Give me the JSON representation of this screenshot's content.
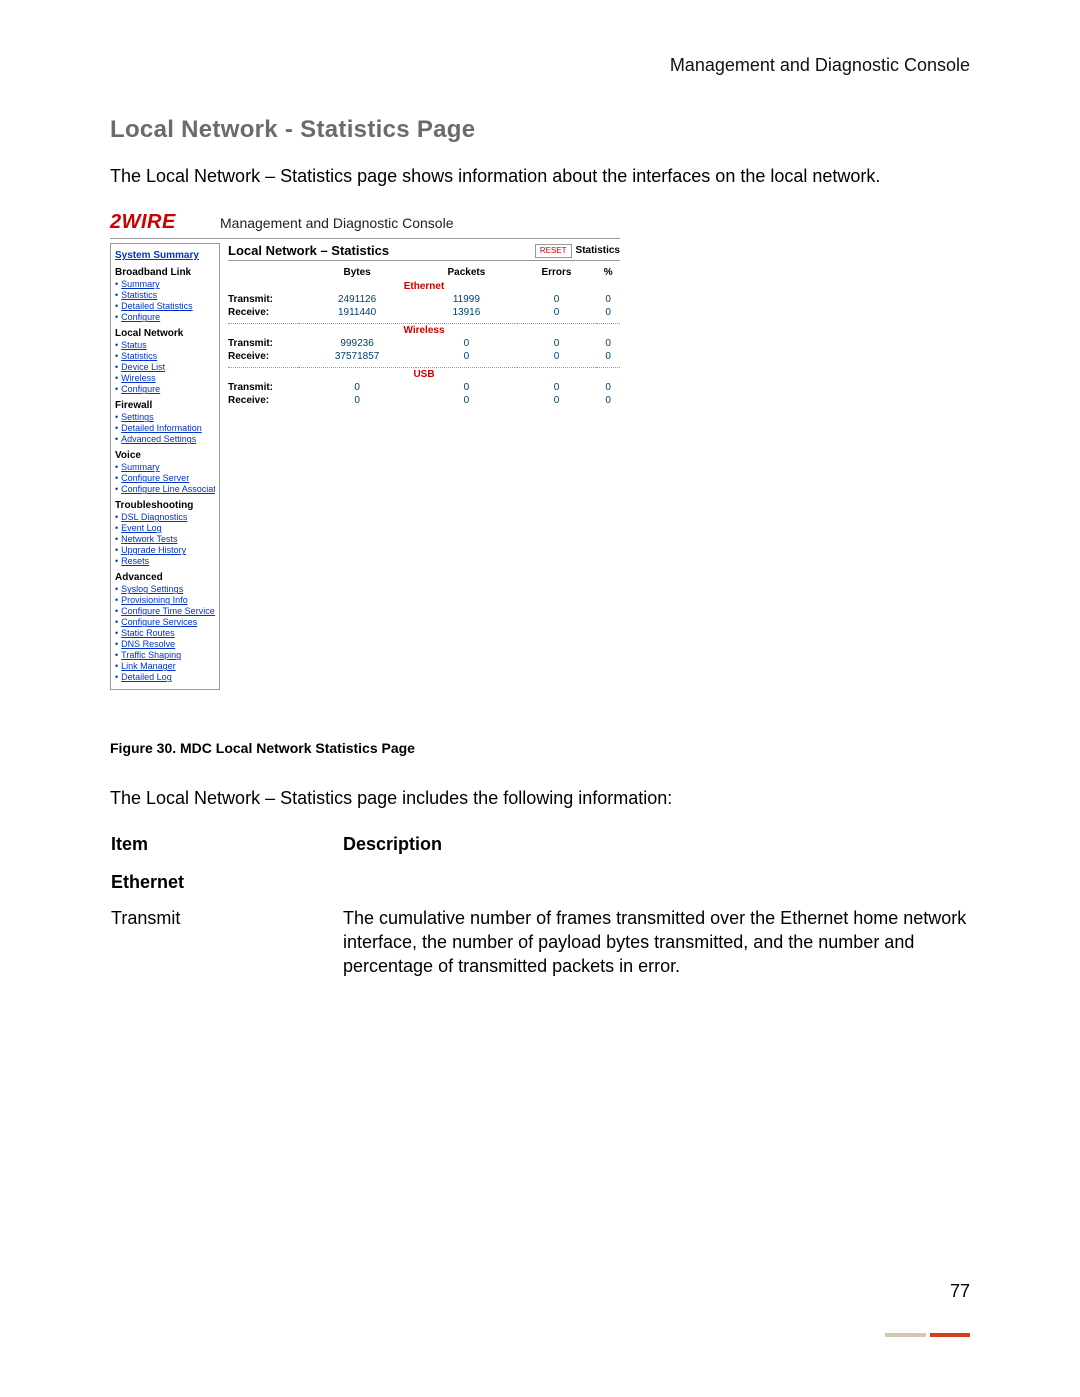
{
  "header_right": "Management and Diagnostic Console",
  "section_title": "Local Network - Statistics Page",
  "intro_text": "The Local Network – Statistics page shows information about the interfaces on the local network.",
  "logo": "2WIRE",
  "console_title": "Management and Diagnostic Console",
  "sidebar": {
    "top_link": "System Summary",
    "sections": [
      {
        "title": "Broadband Link",
        "items": [
          "Summary",
          "Statistics",
          "Detailed Statistics",
          "Configure"
        ]
      },
      {
        "title": "Local Network",
        "items": [
          "Status",
          "Statistics",
          "Device List",
          "Wireless",
          "Configure"
        ]
      },
      {
        "title": "Firewall",
        "items": [
          "Settings",
          "Detailed Information",
          "Advanced Settings"
        ]
      },
      {
        "title": "Voice",
        "items": [
          "Summary",
          "Configure Server",
          "Configure Line Association"
        ]
      },
      {
        "title": "Troubleshooting",
        "items": [
          "DSL Diagnostics",
          "Event Log",
          "Network Tests",
          "Upgrade History",
          "Resets"
        ]
      },
      {
        "title": "Advanced",
        "items": [
          "Syslog Settings",
          "Provisioning Info",
          "Configure Time Services",
          "Configure Services",
          "Static Routes",
          "DNS Resolve",
          "Traffic Shaping",
          "Link Manager",
          "Detailed Log"
        ]
      }
    ]
  },
  "panel": {
    "title": "Local Network – Statistics",
    "reset": "RESET",
    "right_label": "Statistics",
    "columns": [
      "Bytes",
      "Packets",
      "Errors",
      "%"
    ],
    "rows_label_transmit": "Transmit:",
    "rows_label_receive": "Receive:",
    "interfaces": [
      {
        "name": "Ethernet",
        "transmit": [
          "2491126",
          "11999",
          "0",
          "0"
        ],
        "receive": [
          "1911440",
          "13916",
          "0",
          "0"
        ]
      },
      {
        "name": "Wireless",
        "transmit": [
          "999236",
          "0",
          "0",
          "0"
        ],
        "receive": [
          "37571857",
          "0",
          "0",
          "0"
        ]
      },
      {
        "name": "USB",
        "transmit": [
          "0",
          "0",
          "0",
          "0"
        ],
        "receive": [
          "0",
          "0",
          "0",
          "0"
        ]
      }
    ]
  },
  "figure_caption": "Figure 30. MDC Local Network Statistics Page",
  "post_text": "The Local Network – Statistics page includes the following information:",
  "info_table": {
    "head_item": "Item",
    "head_desc": "Description",
    "row_section": "Ethernet",
    "row1_item": "Transmit",
    "row1_desc": "The cumulative number of frames transmitted over the Ethernet home network interface, the number of payload bytes transmitted, and the number and percentage of transmitted packets in error."
  },
  "page_number": "77"
}
